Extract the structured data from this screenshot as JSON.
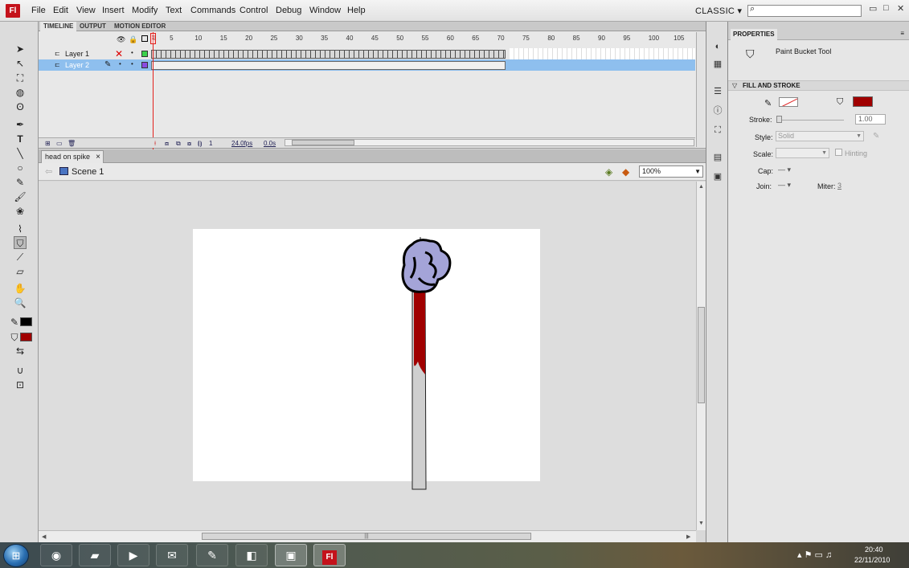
{
  "app": {
    "logo": "Fl",
    "workspace": "CLASSIC",
    "workspace_arrow": "▾"
  },
  "menu": [
    "File",
    "Edit",
    "View",
    "Insert",
    "Modify",
    "Text",
    "Commands",
    "Control",
    "Debug",
    "Window",
    "Help"
  ],
  "search": {
    "value": "",
    "icon": "search-icon"
  },
  "window_controls": {
    "minimize": "▭",
    "maximize": "□",
    "close": "✕"
  },
  "timeline": {
    "tabs": [
      "TIMELINE",
      "OUTPUT",
      "MOTION EDITOR"
    ],
    "frame_numbers": [
      "1",
      "5",
      "10",
      "15",
      "20",
      "25",
      "30",
      "35",
      "40",
      "45",
      "50",
      "55",
      "60",
      "65",
      "70",
      "75",
      "80",
      "85",
      "90",
      "95",
      "100",
      "105"
    ],
    "current_frame": "1",
    "total_frames": 70,
    "layers": [
      {
        "name": "Layer 1",
        "selected": false,
        "status_icon": "x-icon",
        "color": "#3bd14a"
      },
      {
        "name": "Layer 2",
        "selected": true,
        "status_icon": "pencil-icon",
        "color": "#8a4ae0"
      }
    ],
    "footer": {
      "frame": "1",
      "fps": "24.0fps",
      "time": "0.0s"
    }
  },
  "document": {
    "tab": "head on spike",
    "tab_close": "×",
    "scene": "Scene 1",
    "zoom": "100%",
    "stage_color": "#ffffff",
    "art_colors": {
      "head": "#a4a4d8",
      "blood": "#a00000",
      "spike": "#cfcfcf"
    }
  },
  "properties": {
    "tab": "PROPERTIES",
    "menu_icon": "≡",
    "tool_name": "Paint Bucket Tool",
    "section": "FILL AND STROKE",
    "stroke_label": "Stroke:",
    "stroke_value": "1.00",
    "style_label": "Style:",
    "style_value": "Solid",
    "scale_label": "Scale:",
    "scale_value": "",
    "hinting_label": "Hinting",
    "cap_label": "Cap:",
    "join_label": "Join:",
    "miter_label": "Miter:",
    "miter_value": "3",
    "fill_color": "#a00000",
    "stroke_color": "none"
  },
  "tools_colors": {
    "stroke": "#000000",
    "fill": "#a00000"
  },
  "taskbar": {
    "apps": [
      "chrome-icon",
      "explorer-icon",
      "media-player-icon",
      "outlook-icon",
      "paint-icon",
      "sticky-notes-icon",
      "powerpoint-icon",
      "flash-icon"
    ],
    "flash_label": "Fl",
    "time": "20:40",
    "date": "22/11/2010"
  }
}
